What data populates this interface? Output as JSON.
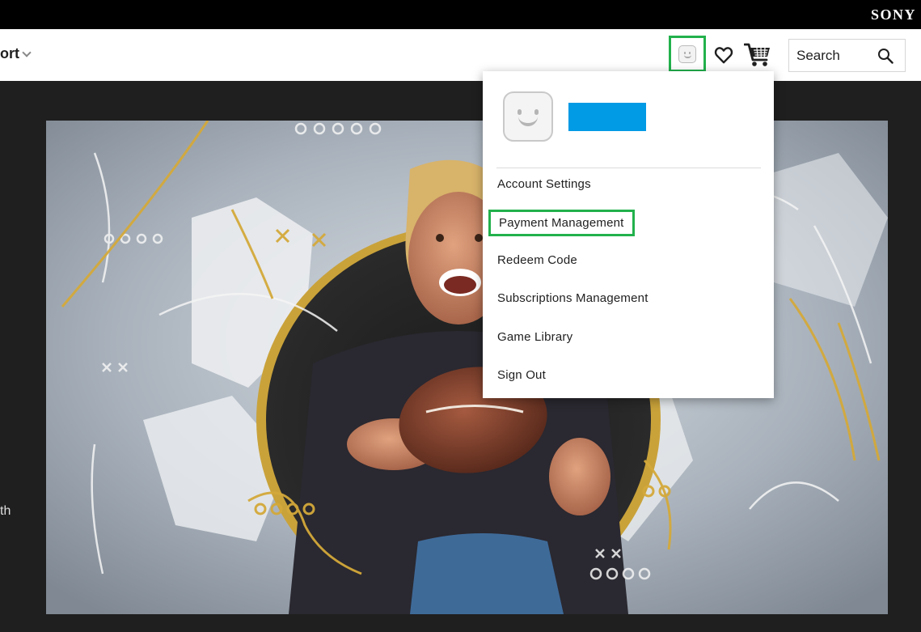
{
  "brand": {
    "logo_text": "SONY"
  },
  "nav": {
    "support_label": "ort",
    "search_label": "Search",
    "icons": {
      "profile": "avatar-icon",
      "wishlist": "heart-icon",
      "cart": "cart-icon",
      "search": "search-icon"
    }
  },
  "account_menu": {
    "username_color": "#009ae5",
    "items": [
      {
        "label": "Account Settings"
      },
      {
        "label": "Payment Management",
        "highlighted": true
      },
      {
        "label": "Redeem Code"
      },
      {
        "label": "Subscriptions Management"
      },
      {
        "label": "Game Library"
      },
      {
        "label": "Sign Out"
      }
    ]
  },
  "page": {
    "left_text_fragment": "th"
  },
  "colors": {
    "highlight": "#22b14c",
    "top_bar": "#000000",
    "nav_bg": "#ffffff",
    "page_bg": "#1f1f1f"
  }
}
